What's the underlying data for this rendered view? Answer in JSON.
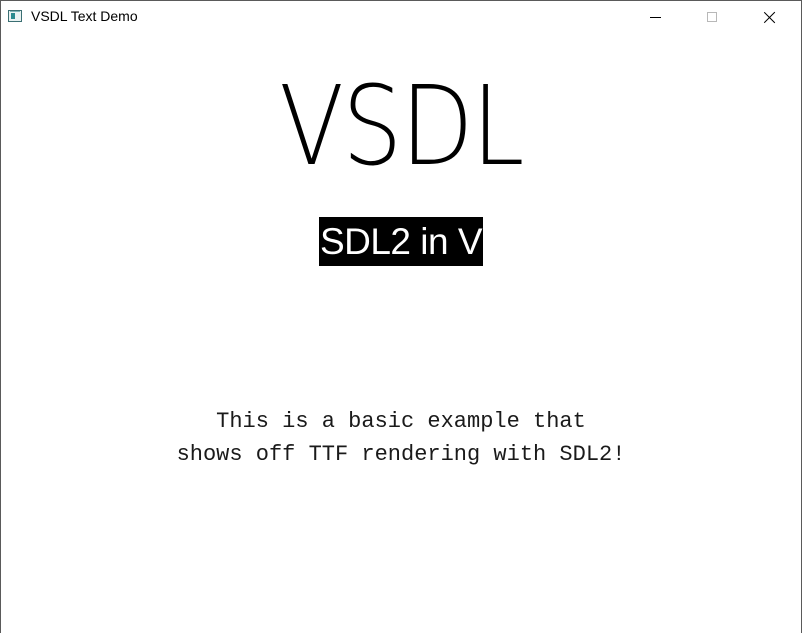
{
  "window": {
    "title": "VSDL Text Demo",
    "app_icon": "sdl-window-icon",
    "controls": {
      "minimize": "minimize-icon",
      "maximize": "maximize-icon",
      "close": "close-icon"
    }
  },
  "content": {
    "headline": "VSDL",
    "subtitle": "SDL2 in V",
    "body_lines": [
      "This is a basic example that",
      "shows off TTF rendering with SDL2!"
    ]
  },
  "colors": {
    "background": "#ffffff",
    "text": "#000000",
    "subtitle_background": "#000000",
    "subtitle_text": "#ffffff"
  }
}
